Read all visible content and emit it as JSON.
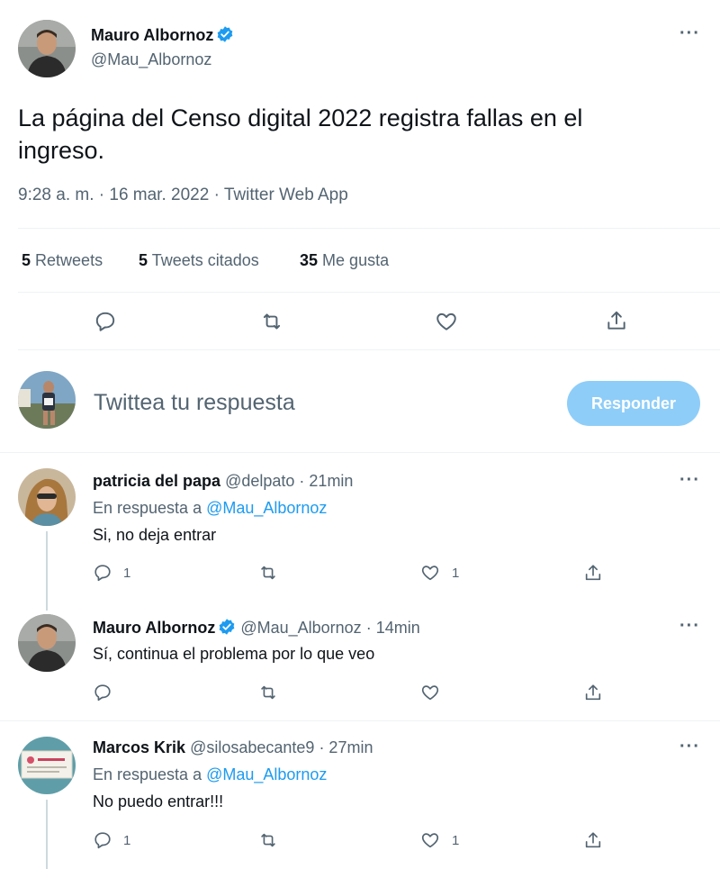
{
  "main_tweet": {
    "author_name": "Mauro Albornoz",
    "author_handle": "@Mau_Albornoz",
    "text_line1": "La página del Censo digital 2022 registra fallas en el",
    "text_line2": "ingreso.",
    "meta": "9:28 a. m. · 16 mar. 2022 · Twitter Web App",
    "stats": {
      "retweets_count": "5",
      "retweets_label": "Retweets",
      "quotes_count": "5",
      "quotes_label": "Tweets citados",
      "likes_count": "35",
      "likes_label": "Me gusta"
    },
    "icons": [
      "reply-icon",
      "retweet-icon",
      "like-icon",
      "share-icon"
    ]
  },
  "composer": {
    "placeholder": "Twittea tu respuesta",
    "reply_button": "Responder"
  },
  "replies": [
    {
      "name": "patricia del papa",
      "handle": "@delpato",
      "time": "· 21min",
      "in_reply_prefix": "En respuesta a",
      "in_reply_handle": "@Mau_Albornoz",
      "text": "Si, no deja entrar",
      "reply_count": "1",
      "like_count": "1"
    },
    {
      "name": "Mauro Albornoz",
      "handle": "@Mau_Albornoz",
      "time": "· 14min",
      "text": "Sí, continua el problema por lo que veo"
    },
    {
      "name": "Marcos Krik",
      "handle": "@silosabecante9",
      "time": "· 27min",
      "in_reply_prefix": "En respuesta a",
      "in_reply_handle": "@Mau_Albornoz",
      "text": "No puedo entrar!!!",
      "reply_count": "1",
      "like_count": "1"
    }
  ],
  "more_glyph": "···",
  "colors": {
    "accent": "#1d9bf0",
    "reply_button_disabled": "#8ecdf8",
    "muted_text": "#536471",
    "divider": "#eff3f4"
  }
}
